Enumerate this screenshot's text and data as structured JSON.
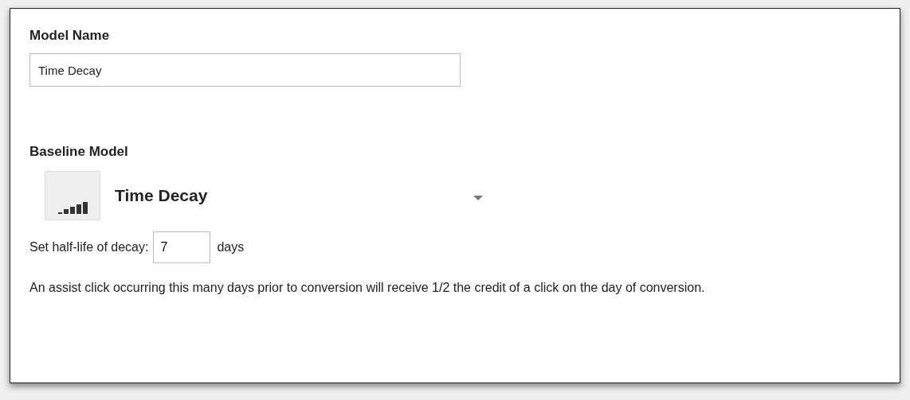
{
  "model_name": {
    "label": "Model Name",
    "value": "Time Decay"
  },
  "baseline_model": {
    "label": "Baseline Model",
    "selected_model": "Time Decay"
  },
  "half_life": {
    "label": "Set half-life of decay:",
    "value": "7",
    "unit": "days"
  },
  "description": "An assist click occurring this many days prior to conversion will receive 1/2 the credit of a click on the day of conversion."
}
